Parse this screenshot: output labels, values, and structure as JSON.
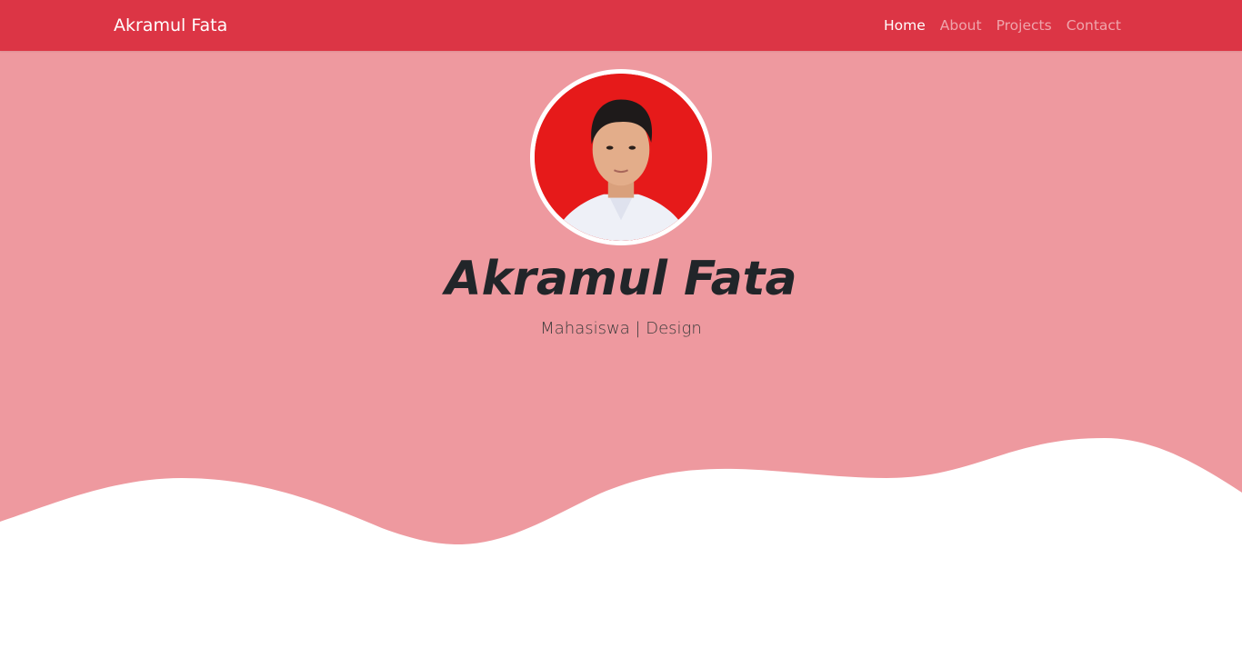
{
  "navbar": {
    "brand": "Akramul Fata",
    "links": [
      {
        "label": "Home",
        "active": true
      },
      {
        "label": "About",
        "active": false
      },
      {
        "label": "Projects",
        "active": false
      },
      {
        "label": "Contact",
        "active": false
      }
    ]
  },
  "hero": {
    "name": "Akramul Fata",
    "subtitle": "Mahasiswa | Design",
    "avatar_icon": "profile-photo"
  },
  "colors": {
    "navbar_bg": "#dc3545",
    "hero_bg": "#ee999f",
    "wave_fill": "#ffffff",
    "text_dark": "#212529",
    "avatar_bg": "#e61a1a"
  }
}
